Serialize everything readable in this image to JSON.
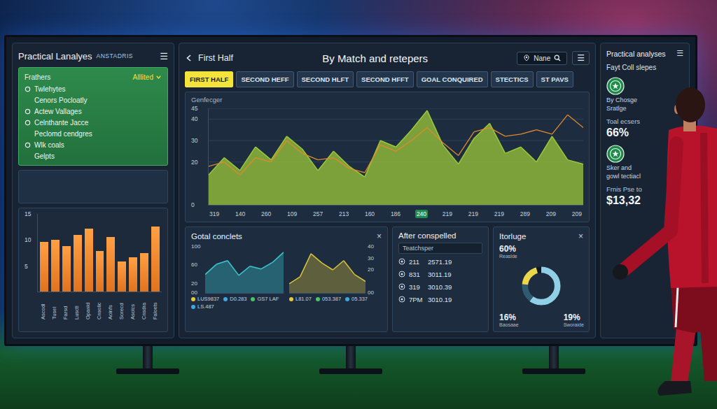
{
  "left_panel": {
    "title": "Practical Lanalyes",
    "subtitle": "ANSTADRIS",
    "menu": "☰",
    "filter": {
      "label": "Frathers",
      "value": "Alllited"
    },
    "items": [
      {
        "text": "Twlehytes",
        "kind": "head"
      },
      {
        "text": "Cenors Pocloatly",
        "kind": "sub"
      },
      {
        "text": "Actew Vallages",
        "kind": "head"
      },
      {
        "text": "Celnthante Jacce",
        "kind": "head"
      },
      {
        "text": "Peclomd cendgres",
        "kind": "sub"
      },
      {
        "text": "Wlk coals",
        "kind": "head"
      },
      {
        "text": "Gelpts",
        "kind": "sub"
      }
    ],
    "bar_chart": {
      "y_ticks": [
        "15",
        "10",
        "5"
      ],
      "values": [
        9.6,
        10,
        8.8,
        11,
        12.2,
        7.9,
        10.5,
        5.8,
        6.6,
        7.5,
        12.6
      ],
      "labels": [
        "Ascodl",
        "Tusel",
        "Farsd",
        "Lusctl",
        "Opanld",
        "Cnsolic",
        "Aoinfs",
        "Sorecd",
        "Asolcs",
        "Cnsdra",
        "Faloets"
      ]
    }
  },
  "center_panel": {
    "back_label": "First Half",
    "title": "By Match and retepers",
    "search": {
      "placeholder": "Nane"
    },
    "menu": "☰",
    "tabs": [
      {
        "label": "FIRST HALF",
        "selected": true
      },
      {
        "label": "SECOND HEFF",
        "selected": false
      },
      {
        "label": "SECOND HLFT",
        "selected": false
      },
      {
        "label": "SECOND HFFT",
        "selected": false
      },
      {
        "label": "GOAL CONQUIRED",
        "selected": false
      },
      {
        "label": "STECTICS",
        "selected": false
      },
      {
        "label": "ST PAVS",
        "selected": false
      }
    ],
    "main_chart": {
      "label": "Genfecger",
      "y_ticks": [
        "45",
        "40",
        "30",
        "20",
        "0"
      ],
      "x_ticks": [
        {
          "label": "319",
          "selected": false
        },
        {
          "label": "140",
          "selected": false
        },
        {
          "label": "260",
          "selected": false
        },
        {
          "label": "109",
          "selected": false
        },
        {
          "label": "257",
          "selected": false
        },
        {
          "label": "213",
          "selected": false
        },
        {
          "label": "160",
          "selected": false
        },
        {
          "label": "186",
          "selected": false
        },
        {
          "label": "240",
          "selected": true
        },
        {
          "label": "219",
          "selected": false
        },
        {
          "label": "219",
          "selected": false
        },
        {
          "label": "219",
          "selected": false
        },
        {
          "label": "289",
          "selected": false
        },
        {
          "label": "209",
          "selected": false
        },
        {
          "label": "209",
          "selected": false
        }
      ],
      "series": [
        {
          "kind": "area",
          "color": "#9cc83a",
          "values": [
            14,
            22,
            16,
            27,
            21,
            32,
            26,
            16,
            25,
            18,
            13,
            30,
            27,
            35,
            44,
            28,
            19,
            31,
            38,
            24,
            27,
            20,
            32,
            21,
            19
          ]
        },
        {
          "kind": "line",
          "color": "#e08a2e",
          "values": [
            18,
            20,
            14,
            22,
            20,
            30,
            24,
            21,
            22,
            17,
            15,
            28,
            25,
            30,
            36,
            29,
            23,
            34,
            36,
            32,
            33,
            35,
            33,
            42,
            36
          ]
        }
      ]
    },
    "goal_card": {
      "title": "Gotal conclets",
      "close": "×",
      "charts": [
        {
          "y_ticks": [
            "100",
            "60",
            "20",
            "00"
          ],
          "values": [
            40,
            62,
            70,
            38,
            58,
            52,
            66,
            88
          ],
          "color": "#3cc8d2",
          "legend": [
            {
              "label": "LUS9837",
              "color": "#e8c93a"
            },
            {
              "label": "D0.283",
              "color": "#3fa8e0"
            },
            {
              "label": "GS7 LAF",
              "color": "#4cc46a"
            },
            {
              "label": "LS.487",
              "color": "#3fa8e0"
            }
          ]
        },
        {
          "y_ticks": [
            "40",
            "30",
            "20",
            "00"
          ],
          "values": [
            8,
            14,
            34,
            26,
            20,
            28,
            16,
            10
          ],
          "color": "#d9c43a",
          "legend": [
            {
              "label": "L81.07",
              "color": "#e8c93a"
            },
            {
              "label": "053.387",
              "color": "#4cc46a"
            },
            {
              "label": "05.337",
              "color": "#3fa8e0"
            }
          ]
        }
      ]
    },
    "after_card": {
      "title": "After conspelled",
      "field": "Teatchsper",
      "rows": [
        {
          "code": "211",
          "value": "2571.19"
        },
        {
          "code": "831",
          "value": "3011.19"
        },
        {
          "code": "319",
          "value": "3010.39"
        },
        {
          "code": "7PM",
          "value": "3010.19"
        }
      ]
    },
    "donut_card": {
      "title": "Itorluge",
      "close": "×",
      "segments": [
        {
          "label": "60%",
          "note": "Reaslde",
          "share": 0.6,
          "color": "#8fd0e6"
        },
        {
          "label": "16%",
          "note": "Baosaae",
          "share": 0.16,
          "color": "#2f5a70"
        },
        {
          "label": "19%",
          "note": "Sworaide",
          "share": 0.19,
          "color": "#e8d84a"
        }
      ]
    }
  },
  "right_panel": {
    "title": "Practical analyses",
    "menu": "☰",
    "heading": "Fayt Coll slepes",
    "sections": [
      {
        "kind": "logo",
        "lines": [
          "By Chosge",
          "Sratlge"
        ]
      },
      {
        "kind": "stat",
        "label": "Toal ecsers",
        "value": "66%"
      },
      {
        "kind": "logo",
        "lines": [
          "Sker and",
          "gowl tectiacl"
        ]
      },
      {
        "kind": "stat",
        "label": "Frnis Pse to",
        "value": "$13,32"
      }
    ]
  }
}
